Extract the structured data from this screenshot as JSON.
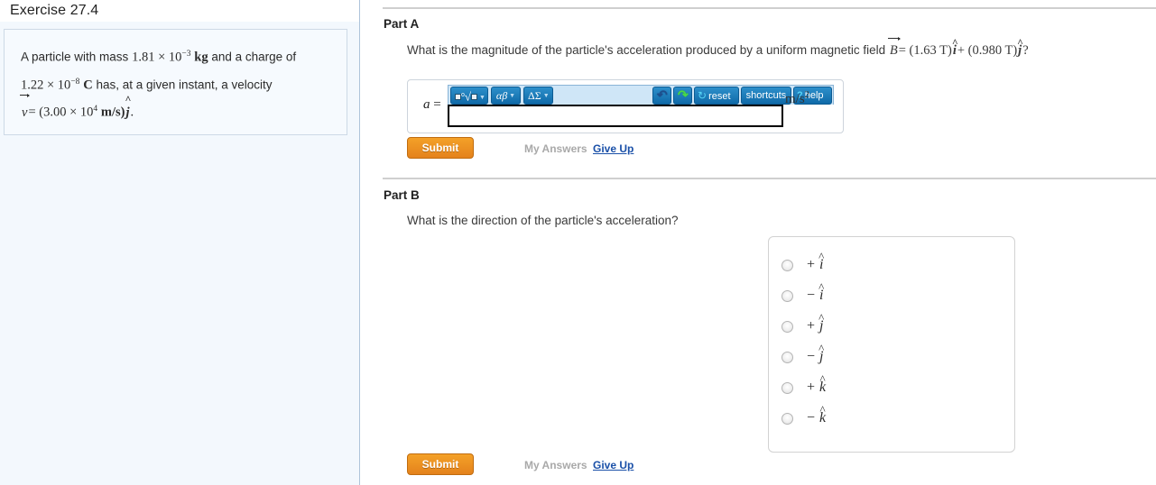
{
  "sidebar": {
    "exercise_title": "Exercise 27.4",
    "problem": {
      "line1_a": "A particle with mass",
      "mass_value": "1.81 × 10",
      "mass_exp": "−3",
      "mass_unit": "kg",
      "line1_b": "and a charge of",
      "charge_value": "1.22 × 10",
      "charge_exp": "−8",
      "charge_unit": "C",
      "line2_b": "has, at a given instant, a velocity",
      "velocity_var": "v",
      "velocity_eq": "= (3.00 × 10",
      "velocity_exp": "4",
      "velocity_units": "m/s)",
      "velocity_hat": "j",
      "velocity_end": "."
    }
  },
  "partA": {
    "heading": "Part A",
    "question_pre": "What is the magnitude of the particle's acceleration produced by a uniform magnetic field",
    "field_var": "B",
    "field_eq": "= (1.63 T)",
    "field_hat1": "i",
    "field_plus": "+ (0.980 T)",
    "field_hat2": "j",
    "field_end": "?",
    "answer_var": "a",
    "answer_eq": "=",
    "answer_value": "",
    "unit": "m/s",
    "unit_exp": "2",
    "toolbar": {
      "template_btn": "template-square-root",
      "greek_btn": "αβ",
      "symbol_btn": "ΔΣ",
      "undo": "undo",
      "redo": "redo",
      "reset": "reset",
      "shortcuts": "shortcuts",
      "help": "help",
      "help_mark": "?"
    },
    "submit_label": "Submit",
    "my_answers_label": "My Answers",
    "give_up_label": "Give Up"
  },
  "partB": {
    "heading": "Part B",
    "question": "What is the direction of the particle's acceleration?",
    "options": [
      {
        "sign": "+",
        "letter": "i",
        "selected": false
      },
      {
        "sign": "−",
        "letter": "i",
        "selected": false
      },
      {
        "sign": "+",
        "letter": "j",
        "selected": false
      },
      {
        "sign": "−",
        "letter": "j",
        "selected": false
      },
      {
        "sign": "+",
        "letter": "k",
        "selected": false
      },
      {
        "sign": "−",
        "letter": "k",
        "selected": false
      }
    ],
    "submit_label": "Submit",
    "my_answers_label": "My Answers",
    "give_up_label": "Give Up"
  },
  "colors": {
    "submit_orange": "#e4821c",
    "link_blue": "#1a50a8",
    "toolbar_blue": "#1d7cbb",
    "sidebar_tint": "#f3f8fd"
  }
}
